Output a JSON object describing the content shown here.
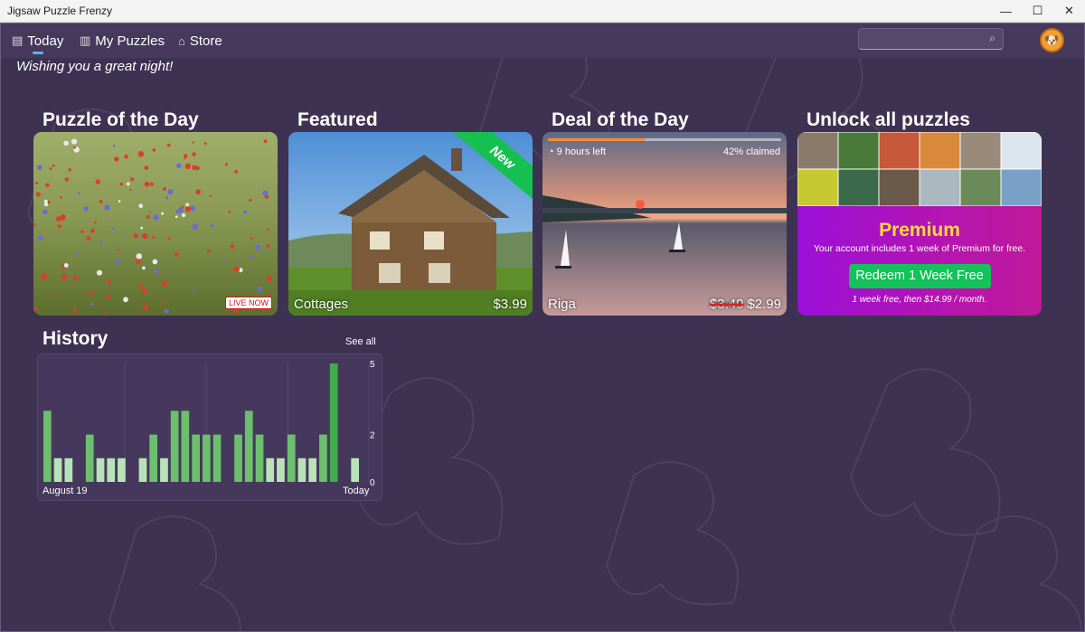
{
  "window": {
    "title": "Jigsaw Puzzle Frenzy",
    "minimize_glyph": "—",
    "maximize_glyph": "☐",
    "close_glyph": "✕"
  },
  "nav": {
    "items": [
      {
        "label": "Today",
        "icon": "calendar-icon",
        "selected": true
      },
      {
        "label": "My Puzzles",
        "icon": "library-icon"
      },
      {
        "label": "Store",
        "icon": "shopping-bag-icon"
      }
    ],
    "search_placeholder": "",
    "avatar_icon": "dog-avatar-icon"
  },
  "greeting": "Wishing you a great night!",
  "sections": {
    "puzzle_of_day": {
      "title": "Puzzle of the Day",
      "badge": "LIVE NOW"
    },
    "featured": {
      "title": "Featured",
      "ribbon": "New",
      "label": "Cottages",
      "price": "$3.99"
    },
    "deal": {
      "title": "Deal of the Day",
      "time_left": "9 hours left",
      "claimed": "42% claimed",
      "claimed_fraction": 0.42,
      "label": "Riga",
      "old_price": "$3.49",
      "price": "$2.99"
    },
    "premium": {
      "title": "Unlock all puzzles",
      "heading": "Premium",
      "subtitle": "Your account includes 1 week of Premium for free.",
      "button": "Redeem 1 Week Free",
      "note": "1 week free, then $14.99 / month."
    }
  },
  "history": {
    "title": "History",
    "see_all": "See all",
    "x_start": "August 19",
    "x_end": "Today"
  },
  "colors": {
    "background": "#3e3252",
    "accent_green": "#13c25a",
    "premium_yellow": "#ffd93b",
    "bar_dark": "#6cbf6c",
    "bar_light": "#b8e3b8",
    "bar_today": "#3fae4a"
  },
  "chart_data": {
    "type": "bar",
    "x_labels": [
      "August 19",
      "Today"
    ],
    "y_ticks": [
      "5",
      "2",
      "0"
    ],
    "ylim": [
      0,
      5
    ],
    "values": [
      3,
      1,
      1,
      0,
      2,
      1,
      1,
      1,
      0,
      1,
      2,
      1,
      3,
      3,
      2,
      2,
      2,
      0,
      2,
      3,
      2,
      1,
      1,
      2,
      1,
      1,
      2,
      5,
      0,
      1
    ],
    "highlight_last_nonzero": true
  }
}
